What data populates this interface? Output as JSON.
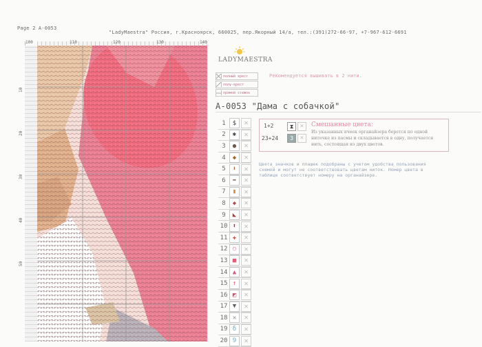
{
  "top_label": "Page 2  A-0053",
  "header": "\"LadyMaestra\" Россия, г.Красноярск, 660025, пер.Якорный 14/а, тел.:(391)272-66-97, +7-967-612-6691",
  "axis": {
    "columns": [
      "100",
      "110",
      "120",
      "130",
      "140"
    ],
    "rows": [
      "10",
      "20",
      "30",
      "40",
      "50"
    ]
  },
  "logo_text": "LADYMAESTRA",
  "legend": [
    "полный крест",
    "полу-крест",
    "прямой стежок"
  ],
  "recommend": "Рекомендуется вышивать в 2 нити.",
  "title": "А-0053 \"Дама с собачкой\"",
  "mix": {
    "heading": "Смешанные цвета:",
    "text": "Из указанных ячеек органайзера берется по одной ниточке из пасмы и складывается в одну, получается нить, состоящая из двух цветов.",
    "row1": "1+2",
    "row2": "23+24"
  },
  "note": "Цвета значков и плашек подобраны с учетом удобства пользования схемой и могут не соответствовать цветам ниток. Номер цвета в таблице соответствует номеру на органайзере.",
  "key": [
    {
      "n": "1",
      "sym": "$",
      "color": "#444"
    },
    {
      "n": "2",
      "sym": "✱",
      "color": "#444"
    },
    {
      "n": "3",
      "sym": "●",
      "color": "#6b5a50"
    },
    {
      "n": "4",
      "sym": "◆",
      "color": "#a0642e"
    },
    {
      "n": "5",
      "sym": "⬇",
      "color": "#b06a3a"
    },
    {
      "n": "6",
      "sym": "➡",
      "color": "#7a4a3a"
    },
    {
      "n": "7",
      "sym": "▮",
      "color": "#d08a40"
    },
    {
      "n": "8",
      "sym": "◆",
      "color": "#b05050"
    },
    {
      "n": "9",
      "sym": "◣",
      "color": "#a04040"
    },
    {
      "n": "10",
      "sym": "⬆",
      "color": "#804040"
    },
    {
      "n": "11",
      "sym": "✚",
      "color": "#c05050"
    },
    {
      "n": "12",
      "sym": "○",
      "color": "#e06a8a"
    },
    {
      "n": "13",
      "sym": "■",
      "color": "#e0607a"
    },
    {
      "n": "14",
      "sym": "▲",
      "color": "#d05a7a"
    },
    {
      "n": "15",
      "sym": "↑",
      "color": "#e05a6a"
    },
    {
      "n": "16",
      "sym": "◩",
      "color": "#c05a6a"
    },
    {
      "n": "17",
      "sym": "▼",
      "color": "#606060"
    },
    {
      "n": "18",
      "sym": "✕",
      "color": "#909090"
    },
    {
      "n": "19",
      "sym": "δ",
      "color": "#6aaacc"
    },
    {
      "n": "20",
      "sym": "9",
      "color": "#6aaacc"
    }
  ]
}
